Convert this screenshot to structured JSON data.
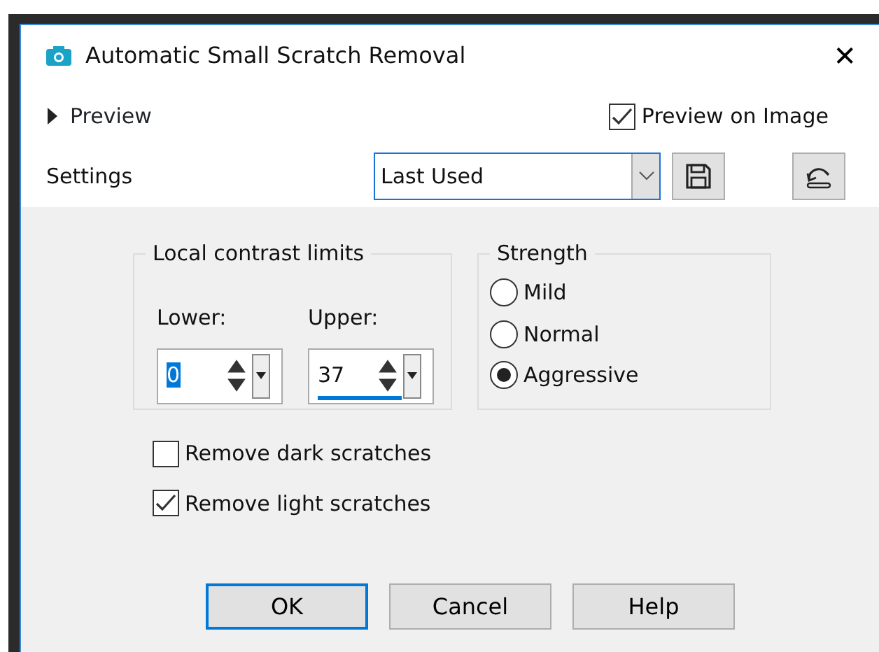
{
  "window": {
    "title": "Automatic Small Scratch Removal",
    "close": "✕"
  },
  "preview": {
    "label": "Preview",
    "expanded": false
  },
  "preview_on_image": {
    "label": "Preview on Image",
    "checked": true
  },
  "settings": {
    "label": "Settings",
    "value": "Last Used"
  },
  "local_contrast_limits": {
    "title": "Local contrast limits",
    "fields": [
      {
        "label": "Lower:",
        "value": "0",
        "focused": false,
        "selected_text": true
      },
      {
        "label": "Upper:",
        "value": "37",
        "focused": true,
        "selected_text": false
      }
    ]
  },
  "strength": {
    "title": "Strength",
    "options": [
      {
        "label": "Mild",
        "selected": false
      },
      {
        "label": "Normal",
        "selected": false
      },
      {
        "label": "Aggressive",
        "selected": true
      }
    ]
  },
  "checkboxes": [
    {
      "label": "Remove dark scratches",
      "checked": false
    },
    {
      "label": "Remove light scratches",
      "checked": true
    }
  ],
  "buttons": [
    {
      "label": "OK",
      "default": true
    },
    {
      "label": "Cancel",
      "default": false
    },
    {
      "label": "Help",
      "default": false
    }
  ]
}
